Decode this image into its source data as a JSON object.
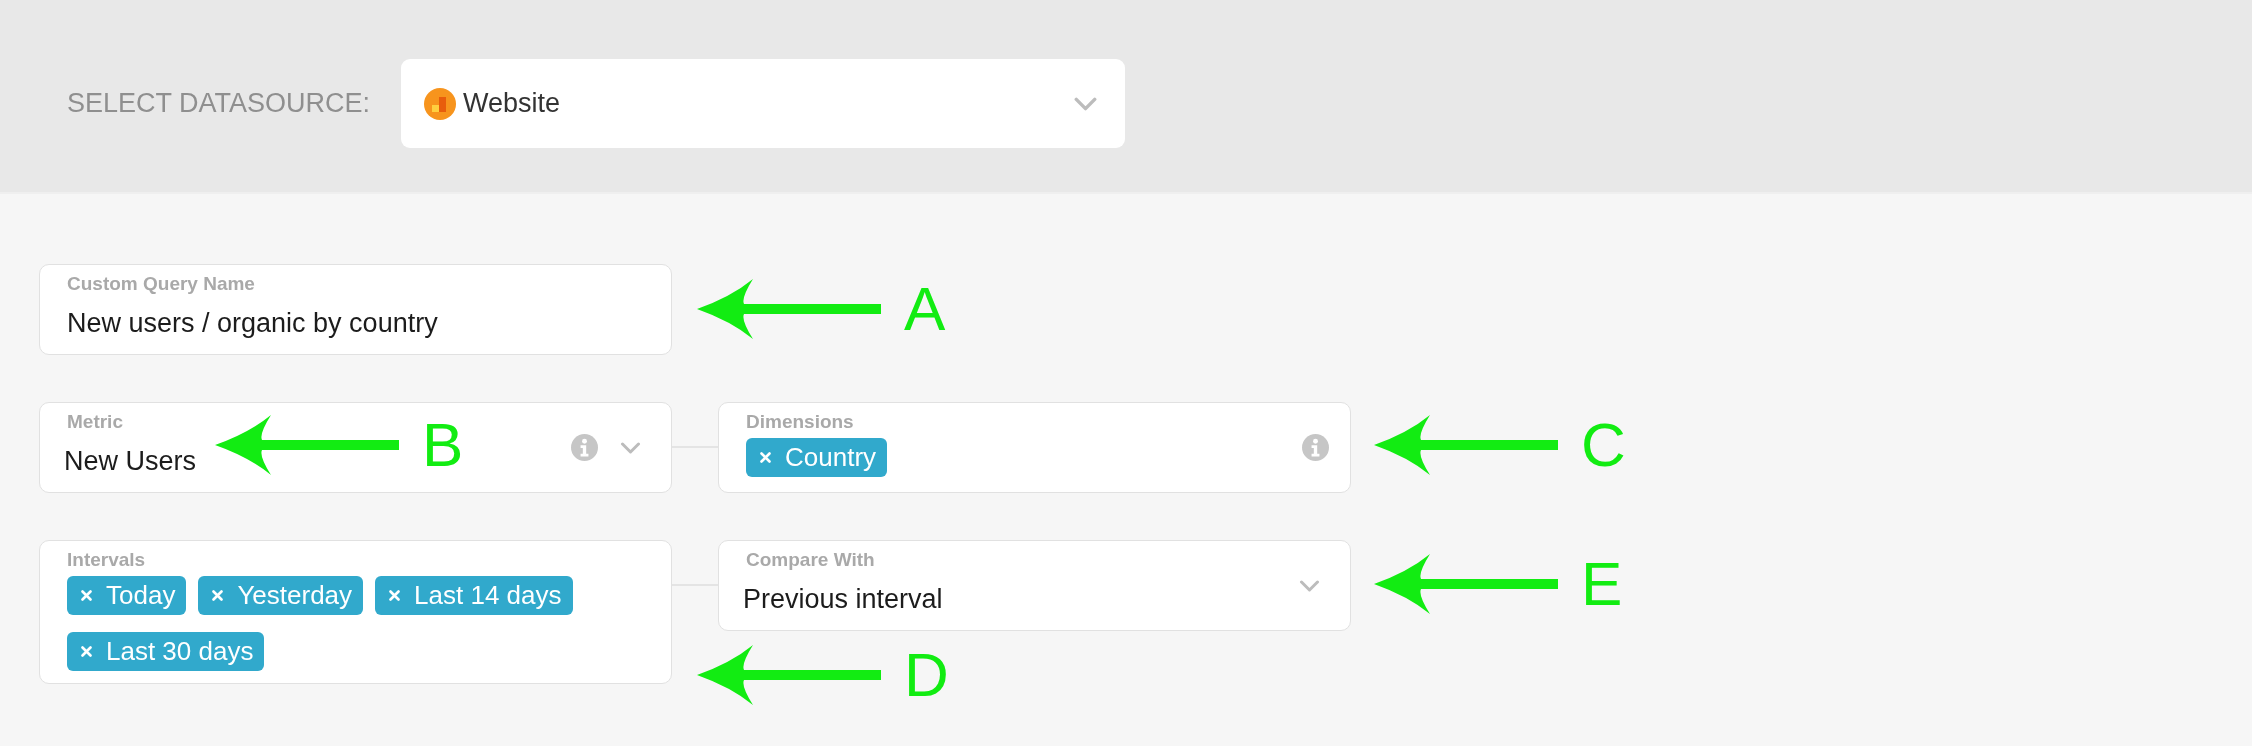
{
  "datasource": {
    "label": "SELECT DATASOURCE:",
    "value": "Website"
  },
  "rows": [
    [
      {
        "kind": "text",
        "label": "Custom Query Name",
        "value": "New users / organic by country",
        "info": false
      }
    ],
    [
      {
        "kind": "select",
        "label": "Metric",
        "value": "New Users",
        "info": true
      },
      {
        "kind": "tags",
        "label": "Dimensions",
        "tags": [
          "Country"
        ],
        "info": true
      }
    ],
    [
      {
        "kind": "tags",
        "label": "Intervals",
        "tags": [
          "Today",
          "Yesterday",
          "Last 14 days",
          "Last 30 days"
        ],
        "info": false
      },
      {
        "kind": "select",
        "label": "Compare With",
        "value": "Previous interval",
        "info": false
      }
    ]
  ],
  "annotations": [
    {
      "letter": "A"
    },
    {
      "letter": "B"
    },
    {
      "letter": "C"
    },
    {
      "letter": "D"
    },
    {
      "letter": "E"
    }
  ]
}
